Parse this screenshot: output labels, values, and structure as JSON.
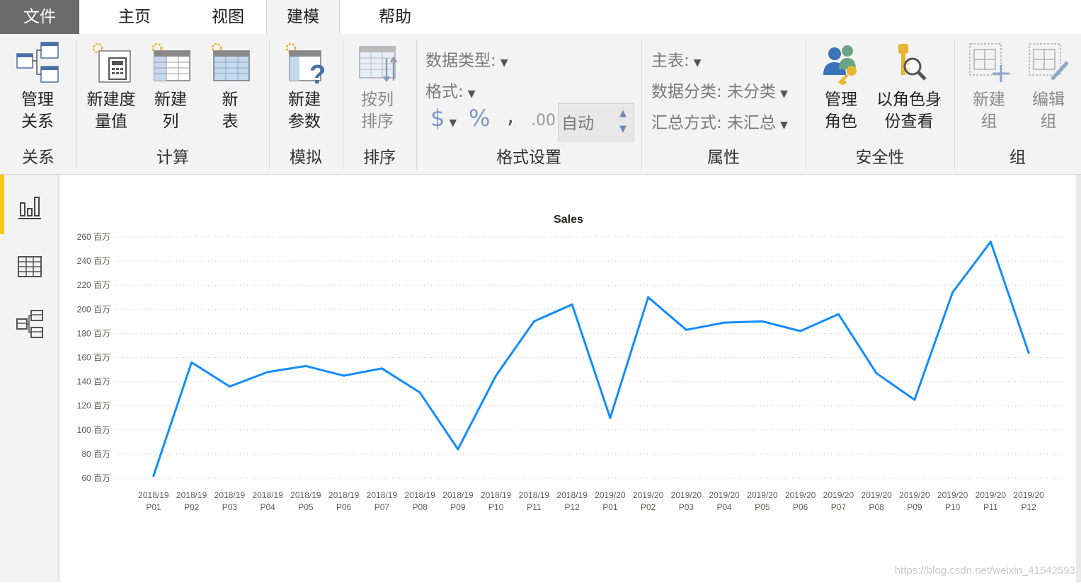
{
  "tabs": [
    {
      "label": "文件"
    },
    {
      "label": "主页"
    },
    {
      "label": "视图"
    },
    {
      "label": "建模"
    },
    {
      "label": "帮助"
    }
  ],
  "ribbon": {
    "relations": {
      "manage_label": "管理\n关系",
      "group": "关系"
    },
    "calc": {
      "new_measure": "新建度\n量值",
      "new_column": "新建\n列",
      "new_table": "新\n表",
      "group": "计算"
    },
    "whatif": {
      "new_param": "新建\n参数",
      "group": "模拟"
    },
    "sort": {
      "sort_by": "按列\n排序",
      "group": "排序"
    },
    "format": {
      "data_type": "数据类型:",
      "format": "格式:",
      "dollar": "$",
      "percent": "%",
      "comma": ",",
      "decimals": ".00",
      "auto": "自动",
      "group": "格式设置"
    },
    "props": {
      "home_table": "主表:",
      "data_category": "数据分类: 未分类",
      "summarize": "汇总方式: 未汇总",
      "group": "属性"
    },
    "security": {
      "manage_roles": "管理\n角色",
      "view_as": "以角色身\n份查看",
      "group": "安全性"
    },
    "groups": {
      "new_group": "新建\n组",
      "edit_group": "编辑\n组",
      "group": "组"
    }
  },
  "sidebar": {
    "items": [
      {
        "icon": "report-view-icon",
        "active": true
      },
      {
        "icon": "data-view-icon",
        "active": false
      },
      {
        "icon": "model-view-icon",
        "active": false
      }
    ]
  },
  "chart_data": {
    "type": "line",
    "title": "Sales",
    "categories": [
      "2018/19 P01",
      "2018/19 P02",
      "2018/19 P03",
      "2018/19 P04",
      "2018/19 P05",
      "2018/19 P06",
      "2018/19 P07",
      "2018/19 P08",
      "2018/19 P09",
      "2018/19 P10",
      "2018/19 P11",
      "2018/19 P12",
      "2019/20 P01",
      "2019/20 P02",
      "2019/20 P03",
      "2019/20 P04",
      "2019/20 P05",
      "2019/20 P06",
      "2019/20 P07",
      "2019/20 P08",
      "2019/20 P09",
      "2019/20 P10",
      "2019/20 P11",
      "2019/20 P12"
    ],
    "values": [
      62,
      156,
      136,
      148,
      153,
      145,
      151,
      131,
      84,
      145,
      190,
      204,
      110,
      210,
      183,
      189,
      190,
      182,
      196,
      147,
      125,
      214,
      256,
      164
    ],
    "ylim": [
      60,
      260
    ],
    "yticks": [
      60,
      80,
      100,
      120,
      140,
      160,
      180,
      200,
      220,
      240,
      260
    ],
    "ytick_labels": [
      "60 百万",
      "80 百万",
      "100 百万",
      "120 百万",
      "140 百万",
      "160 百万",
      "180 百万",
      "200 百万",
      "220 百万",
      "240 百万",
      "260 百万"
    ],
    "color": "#118dff",
    "grid": true
  },
  "watermark": "https://blog.csdn.net/weixin_41542593"
}
